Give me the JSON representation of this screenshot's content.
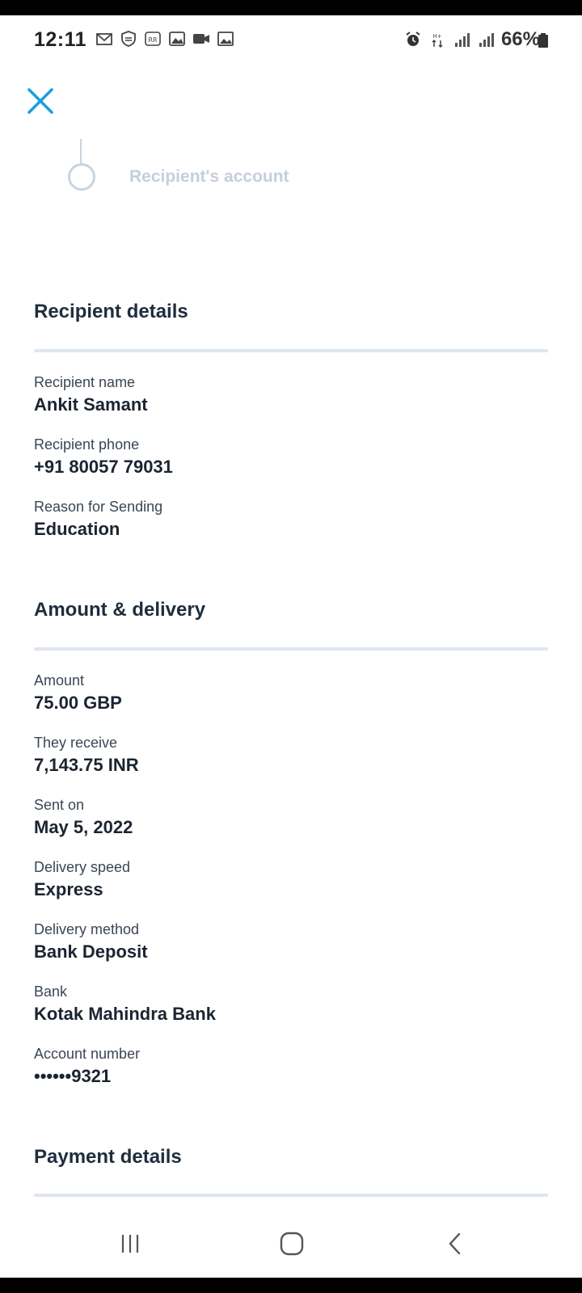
{
  "status_bar": {
    "time": "12:11",
    "battery": "66%",
    "left_icons": [
      "gmail-icon",
      "shield-icon",
      "app-rr-icon",
      "gallery-icon",
      "video-icon",
      "image-icon"
    ],
    "right_icons": [
      "alarm-icon",
      "data-icon",
      "signal-icon",
      "signal-icon",
      "battery-icon"
    ]
  },
  "header": {
    "close_icon": "close-icon",
    "accent_color": "#1a9fd9"
  },
  "stepper": {
    "label": "Recipient's account"
  },
  "recipient_details": {
    "title": "Recipient details",
    "fields": [
      {
        "label": "Recipient name",
        "value": "Ankit Samant"
      },
      {
        "label": "Recipient phone",
        "value": "+91 80057 79031"
      },
      {
        "label": "Reason for Sending",
        "value": "Education"
      }
    ]
  },
  "amount_delivery": {
    "title": "Amount & delivery",
    "fields": [
      {
        "label": "Amount",
        "value": "75.00 GBP"
      },
      {
        "label": "They receive",
        "value": "7,143.75 INR"
      },
      {
        "label": "Sent on",
        "value": "May 5, 2022"
      },
      {
        "label": "Delivery speed",
        "value": "Express"
      },
      {
        "label": "Delivery method",
        "value": "Bank Deposit"
      },
      {
        "label": "Bank",
        "value": "Kotak Mahindra Bank"
      },
      {
        "label": "Account number",
        "value": "••••••9321"
      }
    ]
  },
  "payment_details": {
    "title": "Payment details"
  },
  "nav_bar": {
    "recents_icon": "recents-icon",
    "home_icon": "home-icon",
    "back_icon": "back-icon"
  }
}
